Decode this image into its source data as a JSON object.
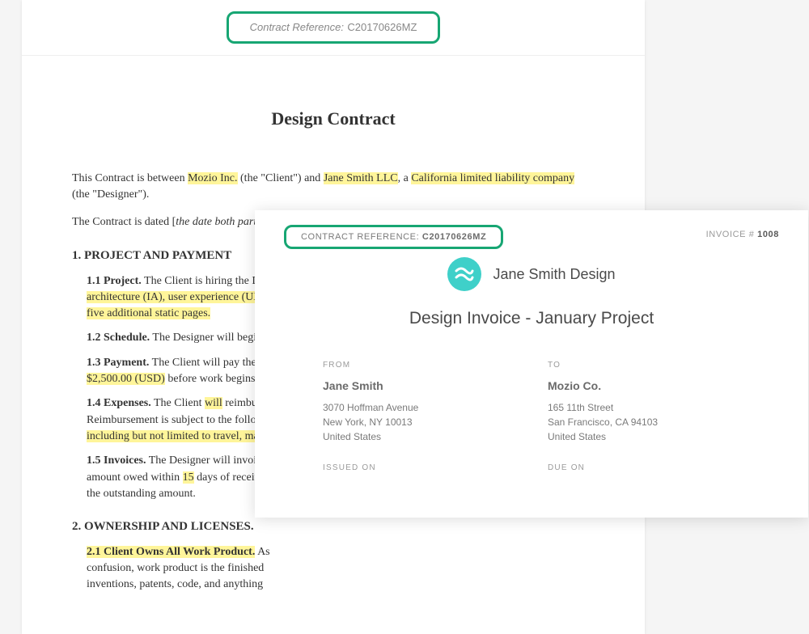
{
  "contract": {
    "reference_label": "Contract Reference:",
    "reference_value": "C20170626MZ",
    "title": "Design Contract",
    "intro": {
      "pre": "This Contract is between ",
      "client": "Mozio Inc.",
      "mid1": " (the \"Client\") and ",
      "designer": "Jane Smith LLC",
      "mid2": ", a ",
      "entity": "California limited liability company",
      "post": " (the \"Designer\")."
    },
    "dated_pre": "The Contract is dated [",
    "dated_sig": "the date both parties sign",
    "dated_post": "].",
    "s1_heading": "1. PROJECT AND PAYMENT",
    "s1_1_label": "1.1 Project.",
    "s1_1_pre": " The Client is hiring the De",
    "s1_1_hl": "architecture (IA), user experience (UX),",
    "s1_1_hl2": "five additional static pages.",
    "s1_2_label": "1.2 Schedule.",
    "s1_2_text": " The Designer will begin ",
    "s1_3_label": "1.3 Payment.",
    "s1_3_text": " The Client will pay the D",
    "s1_3_amount": "$2,500.00 (USD)",
    "s1_3_post": " before work begins.",
    "s1_4_label": "1.4 Expenses.",
    "s1_4_text_pre": " The Client ",
    "s1_4_will": "will",
    "s1_4_text_post": " reimburs",
    "s1_4_line2": "Reimbursement is subject to the followi",
    "s1_4_hl": "including but not limited to travel, mat",
    "s1_5_label": "1.5 Invoices.",
    "s1_5_text": " The Designer will invoice",
    "s1_5_line2_pre": "amount owed within ",
    "s1_5_days": "15",
    "s1_5_line2_post": " days of receivi",
    "s1_5_line3": "the outstanding amount.",
    "s2_heading": "2. OWNERSHIP AND LICENSES.",
    "s2_1_label": "2.1 Client Owns All Work Product.",
    "s2_1_text": " As",
    "s2_1_line2": "confusion, work product is the finished",
    "s2_1_line3": "inventions, patents, code, and anything"
  },
  "invoice": {
    "ref_label": "CONTRACT REFERENCE: ",
    "ref_value": "C20170626MZ",
    "number_label": "INVOICE # ",
    "number_value": "1008",
    "company": "Jane Smith Design",
    "title": "Design Invoice - January Project",
    "from_label": "FROM",
    "to_label": "TO",
    "from": {
      "name": "Jane Smith",
      "line1": "3070 Hoffman Avenue",
      "line2": "New York, NY 10013",
      "line3": "United States"
    },
    "to": {
      "name": "Mozio Co.",
      "line1": "165 11th Street",
      "line2": "San Francisco, CA 94103",
      "line3": "United States"
    },
    "issued_label": "ISSUED ON",
    "due_label": "DUE ON"
  }
}
